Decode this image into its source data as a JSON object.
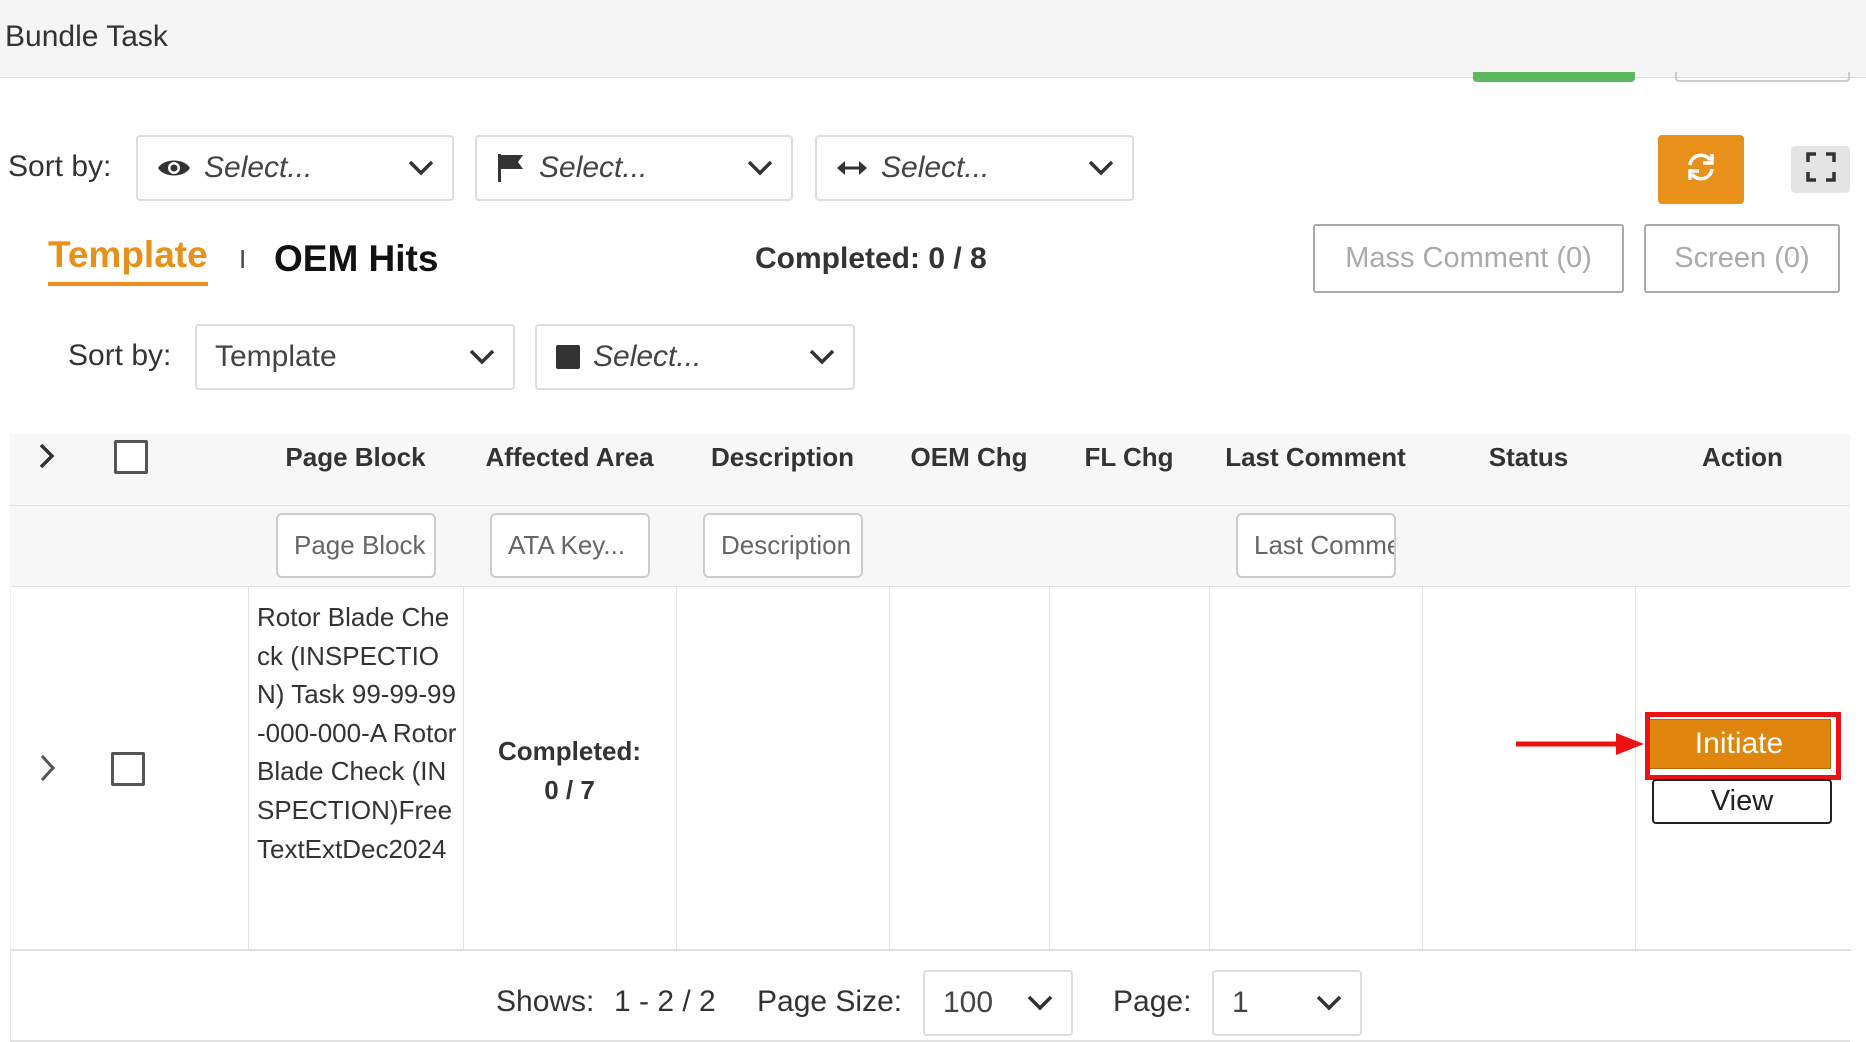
{
  "header": {
    "title": "Bundle Task"
  },
  "sort_bar": {
    "label": "Sort by:",
    "select1": {
      "icon": "eye-icon",
      "value": "Select..."
    },
    "select2": {
      "icon": "flag-icon",
      "value": "Select..."
    },
    "select3": {
      "icon": "horizontal-arrows-icon",
      "value": "Select..."
    },
    "refresh_icon": "refresh-icon",
    "fullscreen_icon": "fullscreen-icon"
  },
  "tabs": {
    "template": "Template",
    "separator": "I",
    "oem_hits": "OEM Hits"
  },
  "completed_summary": "Completed: 0 / 8",
  "buttons": {
    "mass_comment": "Mass Comment (0)",
    "screen": "Screen (0)"
  },
  "sort_bar2": {
    "label": "Sort by:",
    "select1": {
      "value": "Template"
    },
    "select2": {
      "icon": "square-icon",
      "value": "Select..."
    }
  },
  "table": {
    "columns": [
      "Page Block",
      "Affected Area",
      "Description",
      "OEM Chg",
      "FL Chg",
      "Last Comment",
      "Status",
      "Action"
    ],
    "filters": {
      "page_block": "Page Block",
      "ata_key": "ATA Key...",
      "description": "Description",
      "last_comment": "Last Comment"
    },
    "rows": [
      {
        "page_block": "Rotor Blade Check (INSPECTION) Task 99-99-99-000-000-A Rotor Blade Check (INSPECTION)FreeTextExtDec2024",
        "affected_area_line1": "Completed:",
        "affected_area_line2": "0 / 7",
        "action_primary": "Initiate",
        "action_secondary": "View"
      }
    ]
  },
  "pagination": {
    "shows_label": "Shows:",
    "shows_value": "1 - 2 / 2",
    "page_size_label": "Page Size:",
    "page_size_value": "100",
    "page_label": "Page:",
    "page_value": "1"
  },
  "colors": {
    "accent": "#e8901a",
    "highlight": "#ee1111",
    "success": "#5cb85c"
  }
}
